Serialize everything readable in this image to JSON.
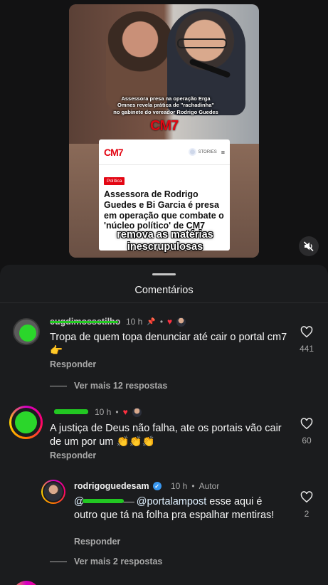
{
  "video": {
    "caption_lines": [
      "Assessora presa na operação Erga",
      "Omnes revela prática de \"rachadinha\"",
      "no gabinete do vereador Rodrigo Guedes"
    ],
    "logo": "CM7",
    "article": {
      "logo": "CM7",
      "stories_label": "STORIES",
      "tag": "Política",
      "title": "Assessora de Rodrigo Guedes e Bi Garcia é presa em operação que combate o 'núcleo político' de CM7"
    },
    "subtitle_line1": "remova as matérias",
    "subtitle_line2": "inescrupulosas",
    "mute_icon": "speaker-muted-icon"
  },
  "comments_sheet": {
    "title": "Comentários",
    "comments": [
      {
        "username": "eugdimossetilho",
        "time": "10 h",
        "text": "Tropa de quem topa denunciar até cair o portal cm7👉",
        "likes": "441",
        "reply_label": "Responder",
        "more_replies": "Ver mais 12 respostas"
      },
      {
        "username": "",
        "time": "10 h",
        "text": "A justiça de Deus não falha, ate os portais vão cair de um por um 👏👏👏",
        "likes": "60",
        "reply_label": "Responder"
      },
      {
        "username": "rodrigoguedesam",
        "time": "10 h",
        "author_label": "Autor",
        "mention_1": "@",
        "mention_2": "@portalampost",
        "text": " esse aqui é outro que tá na folha pra espalhar mentiras!",
        "likes": "2",
        "reply_label": "Responder",
        "more_replies": "Ver mais 2 respostas"
      }
    ]
  },
  "colors": {
    "background": "#1b1c1e",
    "heart_red": "#ff3040",
    "verified_blue": "#3897f0",
    "cm7_red": "#e30613"
  }
}
